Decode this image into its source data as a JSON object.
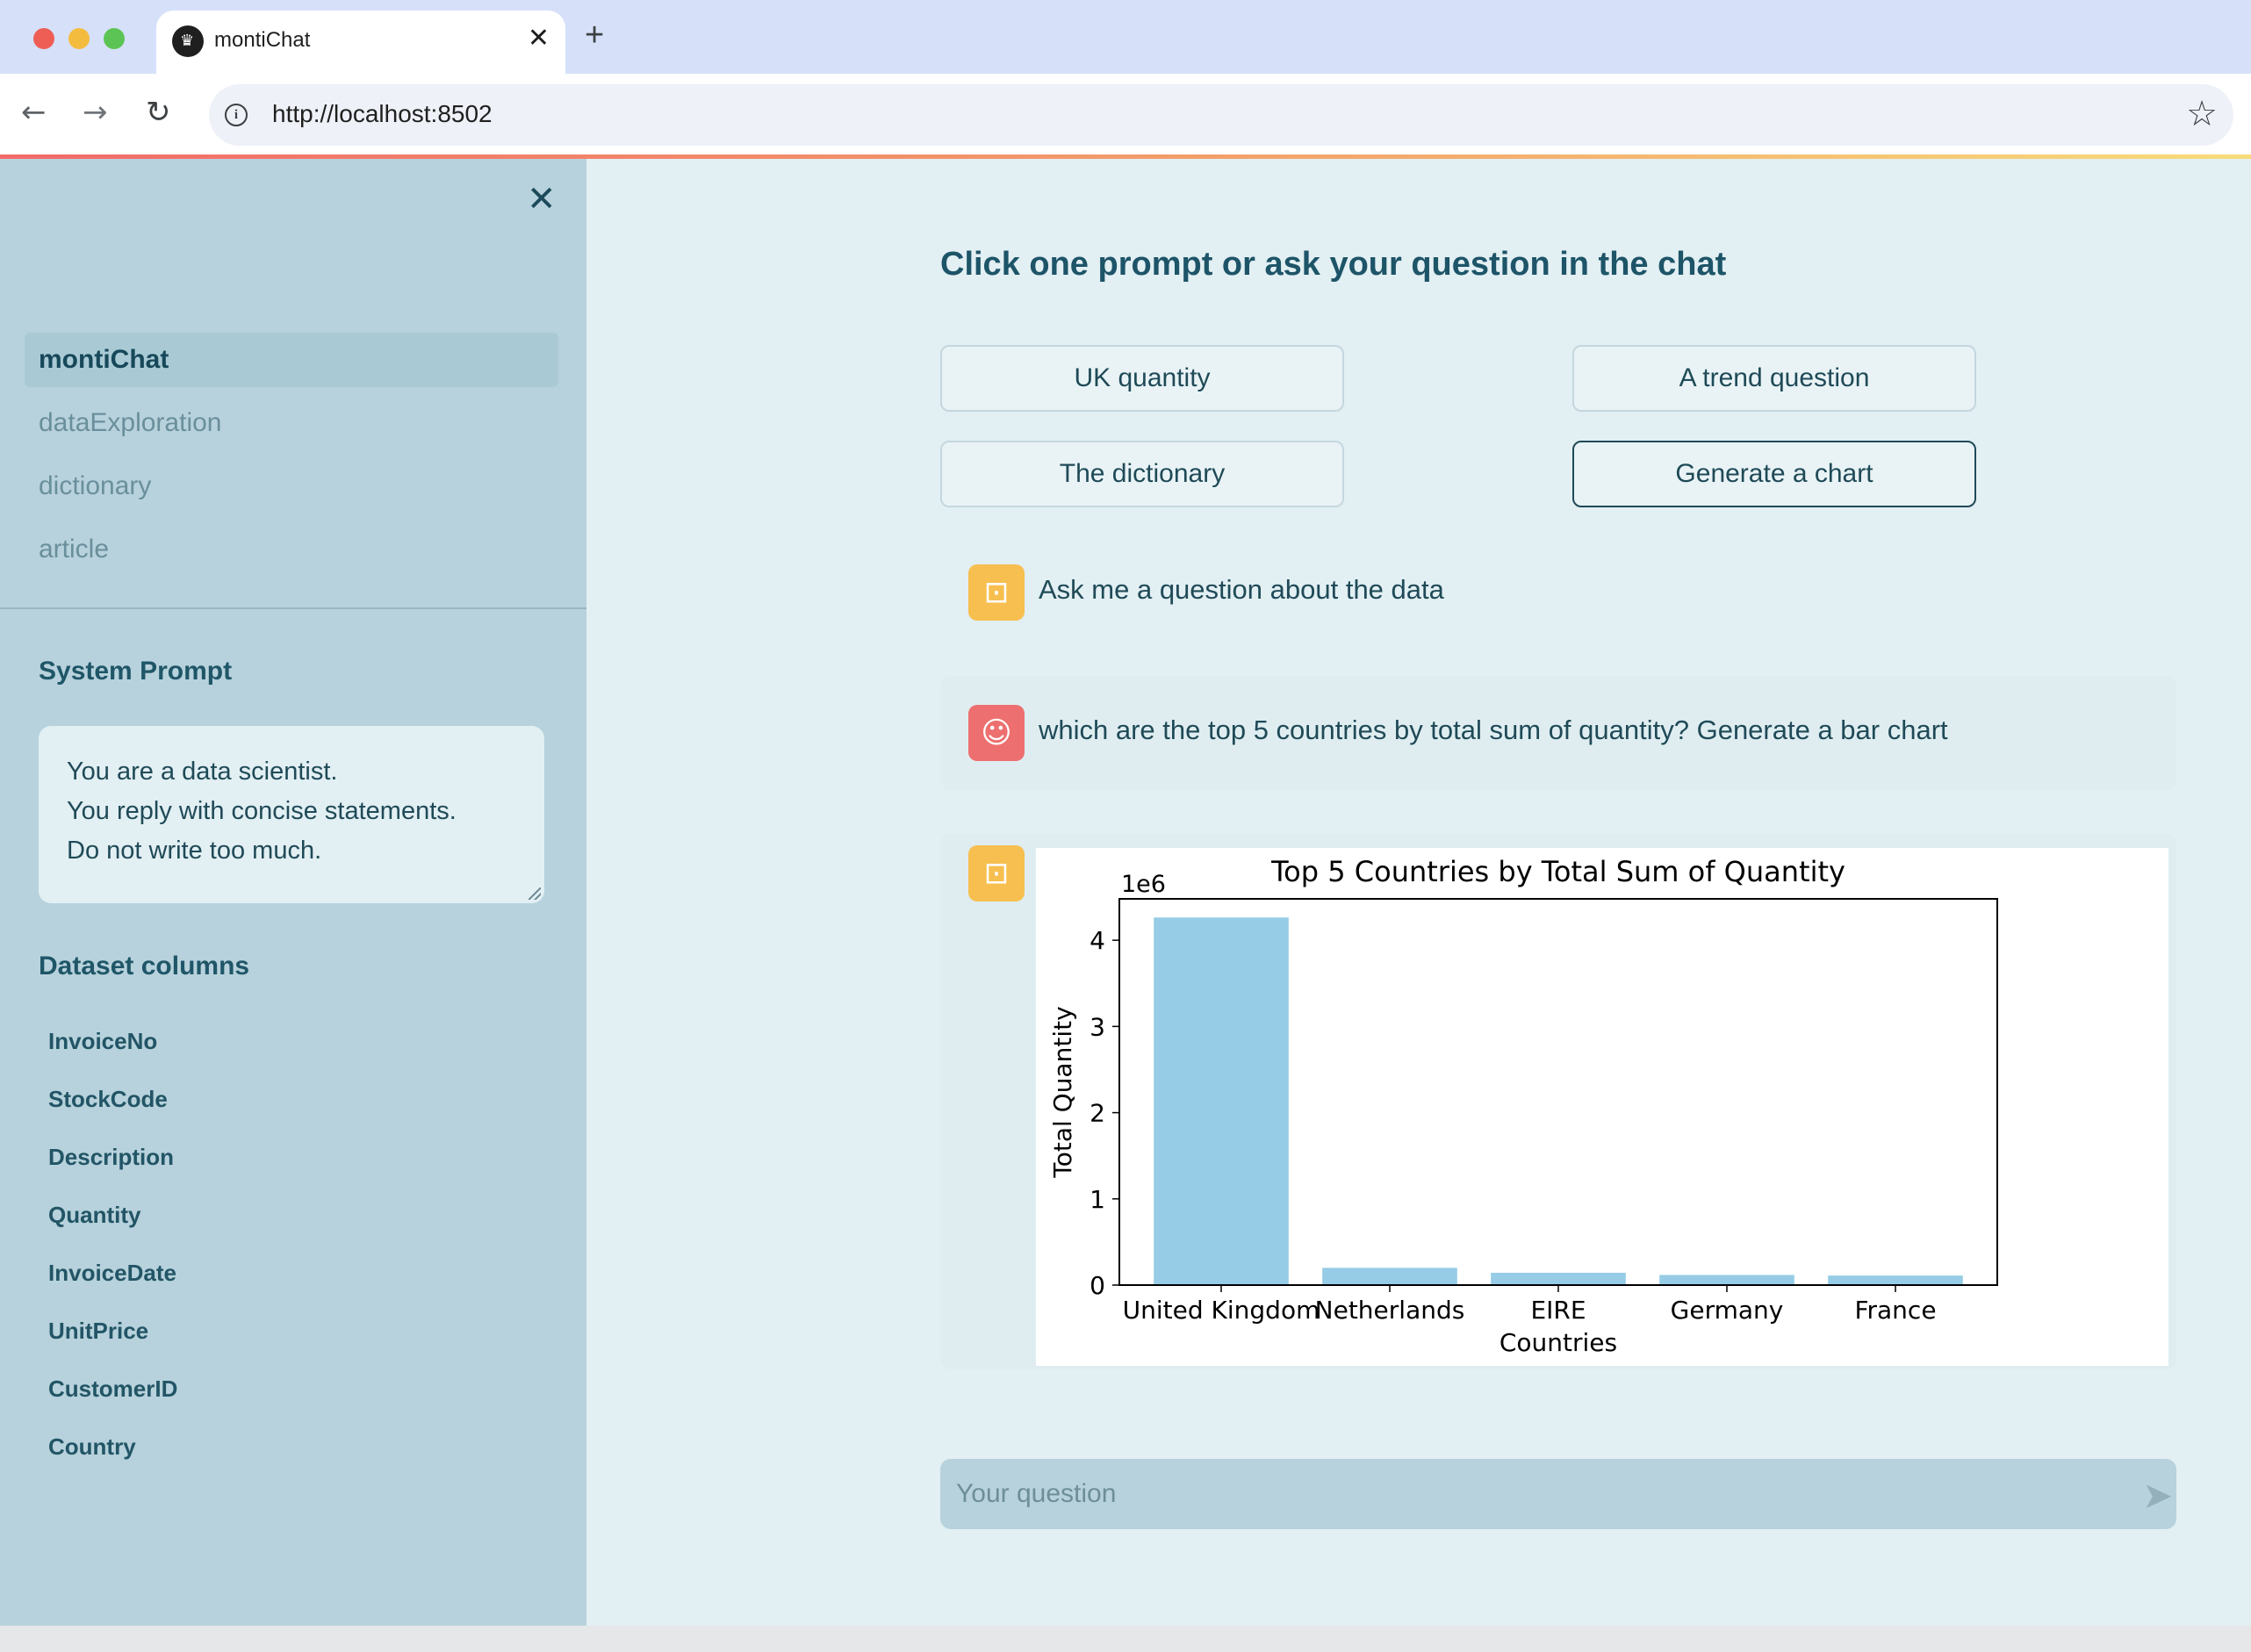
{
  "browser": {
    "tab_title": "montiChat",
    "tab_close": "✕",
    "new_tab": "+",
    "url": "http://localhost:8502"
  },
  "sidebar": {
    "close_icon": "✕",
    "nav": [
      {
        "label": "montiChat",
        "active": true
      },
      {
        "label": "dataExploration",
        "active": false
      },
      {
        "label": "dictionary",
        "active": false
      },
      {
        "label": "article",
        "active": false
      }
    ],
    "system_prompt_label": "System Prompt",
    "system_prompt_lines": [
      "You are a data scientist.",
      "You reply with concise statements.",
      "Do not write too much."
    ],
    "dataset_columns_label": "Dataset columns",
    "columns": [
      "InvoiceNo",
      "StockCode",
      "Description",
      "Quantity",
      "InvoiceDate",
      "UnitPrice",
      "CustomerID",
      "Country"
    ]
  },
  "main": {
    "heading": "Click one prompt or ask your question in the chat",
    "prompts": [
      "UK quantity",
      "A trend question",
      "The dictionary",
      "Generate a chart"
    ],
    "messages": [
      {
        "role": "assistant",
        "text": "Ask me a question about the data"
      },
      {
        "role": "user",
        "text": "which are the top 5 countries by total sum of quantity? Generate a bar chart"
      }
    ],
    "input_placeholder": "Your question"
  },
  "colors": {
    "accent": "#1f4a57",
    "bar": "#96cce6",
    "bot_avatar": "#f7bf4f",
    "user_avatar": "#ee6f6f"
  },
  "chart_data": {
    "type": "bar",
    "title": "Top 5 Countries by Total Sum of Quantity",
    "xlabel": "Countries",
    "ylabel": "Total Quantity",
    "y_scale_label": "1e6",
    "categories": [
      "United Kingdom",
      "Netherlands",
      "EIRE",
      "Germany",
      "France"
    ],
    "values": [
      4263829,
      200128,
      142637,
      117448,
      110480
    ],
    "ylim": [
      0,
      4.48
    ],
    "ytick_values": [
      0,
      1,
      2,
      3,
      4
    ],
    "ytick_labels": [
      "0",
      "1",
      "2",
      "3",
      "4"
    ],
    "grid": false
  }
}
